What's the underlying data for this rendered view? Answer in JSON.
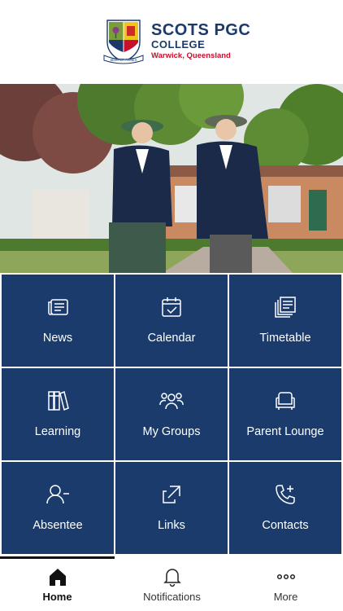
{
  "header": {
    "brand_line1": "SCOTS PGC",
    "brand_line2": "COLLEGE",
    "brand_line3": "Warwick, Queensland",
    "crest_motto": "SEMPER ANNEX",
    "colors": {
      "navy": "#1b3a6b",
      "red": "#c8102e"
    }
  },
  "tiles": [
    {
      "label": "News",
      "icon": "newspaper-icon"
    },
    {
      "label": "Calendar",
      "icon": "calendar-check-icon"
    },
    {
      "label": "Timetable",
      "icon": "stacked-pages-icon"
    },
    {
      "label": "Learning",
      "icon": "books-icon"
    },
    {
      "label": "My Groups",
      "icon": "group-icon"
    },
    {
      "label": "Parent Lounge",
      "icon": "armchair-icon"
    },
    {
      "label": "Absentee",
      "icon": "user-minus-icon"
    },
    {
      "label": "Links",
      "icon": "external-link-icon"
    },
    {
      "label": "Contacts",
      "icon": "phone-add-icon"
    }
  ],
  "bottom_nav": [
    {
      "label": "Home",
      "icon": "home-icon",
      "active": true
    },
    {
      "label": "Notifications",
      "icon": "bell-icon",
      "active": false
    },
    {
      "label": "More",
      "icon": "more-dots-icon",
      "active": false
    }
  ],
  "tile_color": "#1a3b6b"
}
